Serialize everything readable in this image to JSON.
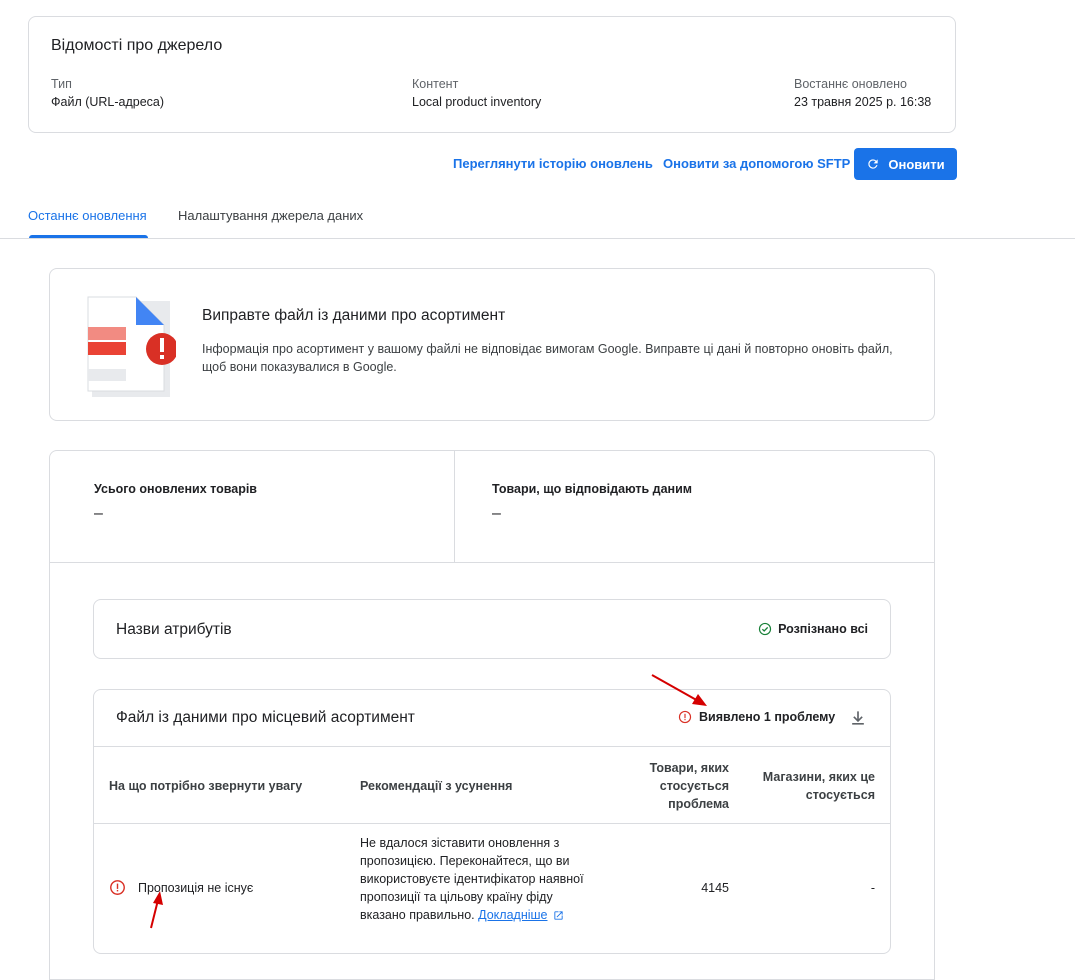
{
  "source_details": {
    "title": "Відомості про джерело",
    "type_label": "Тип",
    "type_value": "Файл (URL-адреса)",
    "content_label": "Контент",
    "content_value": "Local product inventory",
    "updated_label": "Востаннє оновлено",
    "updated_value": "23 травня 2025 р. 16:38"
  },
  "actions": {
    "history_link": "Переглянути історію оновлень",
    "sftp_link": "Оновити за допомогою SFTP",
    "refresh_button": "Оновити"
  },
  "tabs": [
    {
      "label": "Останнє оновлення",
      "active": true
    },
    {
      "label": "Налаштування джерела даних",
      "active": false
    }
  ],
  "alert": {
    "title": "Виправте файл із даними про асортимент",
    "text": "Інформація про асортимент у вашому файлі не відповідає вимогам Google. Виправте ці дані й повторно оновіть файл, щоб вони показувалися в Google."
  },
  "stats": {
    "total_label": "Усього оновлених товарів",
    "total_value": "–",
    "matched_label": "Товари, що відповідають даним",
    "matched_value": "–"
  },
  "attributes": {
    "title": "Назви атрибутів",
    "status": "Розпізнано всі"
  },
  "inventory": {
    "title": "Файл із даними про місцевий асортимент",
    "status": "Виявлено 1 проблему",
    "columns": [
      "На що потрібно звернути увагу",
      "Рекомендації з усунення",
      "Товари, яких стосується проблема",
      "Магазини, яких це стосується"
    ],
    "rows": [
      {
        "issue": "Пропозиція не існує",
        "recommendation": "Не вдалося зіставити оновлення з пропозицією. Переконайтеся, що ви використовуєте ідентифікатор наявної пропозиції та цільову країну фіду вказано правильно.",
        "learn_more": "Докладніше",
        "products": "4145",
        "stores": "-"
      }
    ]
  },
  "colors": {
    "accent": "#1a73e8",
    "error": "#d93025",
    "success": "#188038",
    "annotation_arrow": "#d50000"
  }
}
